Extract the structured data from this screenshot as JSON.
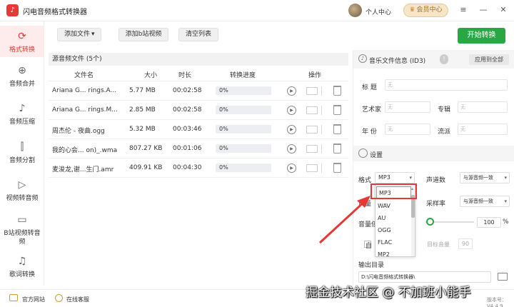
{
  "app": {
    "logo_glyph": "♪",
    "title": "闪电音频格式转换器",
    "user_center": "个人中心",
    "member_center": "会员中心",
    "version": "版本号：V4.4.9"
  },
  "window_controls": {
    "menu": "≡",
    "minimize": "—",
    "close": "✕"
  },
  "sidebar": {
    "items": [
      {
        "label": "格式转换",
        "icon": "refresh-icon",
        "glyph": "⟳"
      },
      {
        "label": "音频合并",
        "icon": "merge-icon",
        "glyph": "⊕"
      },
      {
        "label": "音频压缩",
        "icon": "music-note-icon",
        "glyph": "♪"
      },
      {
        "label": "音频分割",
        "icon": "split-icon",
        "glyph": "⫿"
      },
      {
        "label": "视频转音频",
        "icon": "video-play-icon",
        "glyph": "▷"
      },
      {
        "label": "B站视频转音频",
        "icon": "tv-icon",
        "glyph": "▭"
      },
      {
        "label": "歌词转换",
        "icon": "lyrics-icon",
        "glyph": "♫"
      }
    ]
  },
  "toolbar": {
    "add_file": "添加文件",
    "add_dropdown": "▾",
    "add_bilibili": "添加b站视频",
    "clear_list": "清空列表",
    "start_convert": "开始转换"
  },
  "filelist": {
    "header": "源音频文件 (5个)",
    "columns": [
      "文件名",
      "大小",
      "时长",
      "转换进度",
      "操作"
    ],
    "rows": [
      {
        "name": "Ariana G... rings.A...",
        "size": "5.77 MB",
        "duration": "00:02:58",
        "progress": "0%",
        "play": "▶"
      },
      {
        "name": "Ariana G... rings.M...",
        "size": "2.85 MB",
        "duration": "00:02:58",
        "progress": "0%",
        "play": "▶"
      },
      {
        "name": "周杰伦 - 夜曲.ogg",
        "size": "5.32 MB",
        "duration": "00:03:46",
        "progress": "0%",
        "play": "▶"
      },
      {
        "name": "我的心会... on)_.wma",
        "size": "807.27 KB",
        "duration": "00:01:06",
        "progress": "0%",
        "play": "▶"
      },
      {
        "name": "麦浚龙,谢...生门.amr",
        "size": "409.91 KB",
        "duration": "00:04:30",
        "progress": "0%",
        "play": "▶"
      }
    ]
  },
  "id3": {
    "title": "音乐文件信息 (ID3)",
    "icon_glyph": "♪",
    "info": "!",
    "apply_all": "应用到全部",
    "labels": {
      "title": "标  题",
      "artist": "艺术家",
      "album": "专辑",
      "year": "年  份",
      "genre": "流派"
    },
    "placeholder": "无"
  },
  "settings": {
    "title": "设置",
    "format_label": "格式",
    "format_value": "MP3",
    "channels_label": "声道数",
    "channels_value": "与源音频一致",
    "samplerate_label": "采样率",
    "samplerate_value": "与源音频一致",
    "bitrate_label_partial": "质量",
    "volume_label_partial": "音量倍",
    "volume_value": "100",
    "volume_unit": "%",
    "auto_label_partial": "自",
    "target_volume_label": "目标音量",
    "target_volume_value": "90",
    "output_dir_label": "输出目录",
    "output_dir_value": "D:\\闪电音频格式转换器\\",
    "select_arrow": "▾"
  },
  "dropdown": {
    "options": [
      "MP3",
      "WAV",
      "AU",
      "OGG",
      "FLAC",
      "MP2"
    ],
    "selected": "MP3",
    "scroll_up": "▴"
  },
  "bottombar": {
    "website": "官方网站",
    "support": "在线客服"
  },
  "watermark": "掘金技术社区 @ 不加班小能手",
  "colors": {
    "accent": "#e53935",
    "start_button": "#29a745"
  }
}
